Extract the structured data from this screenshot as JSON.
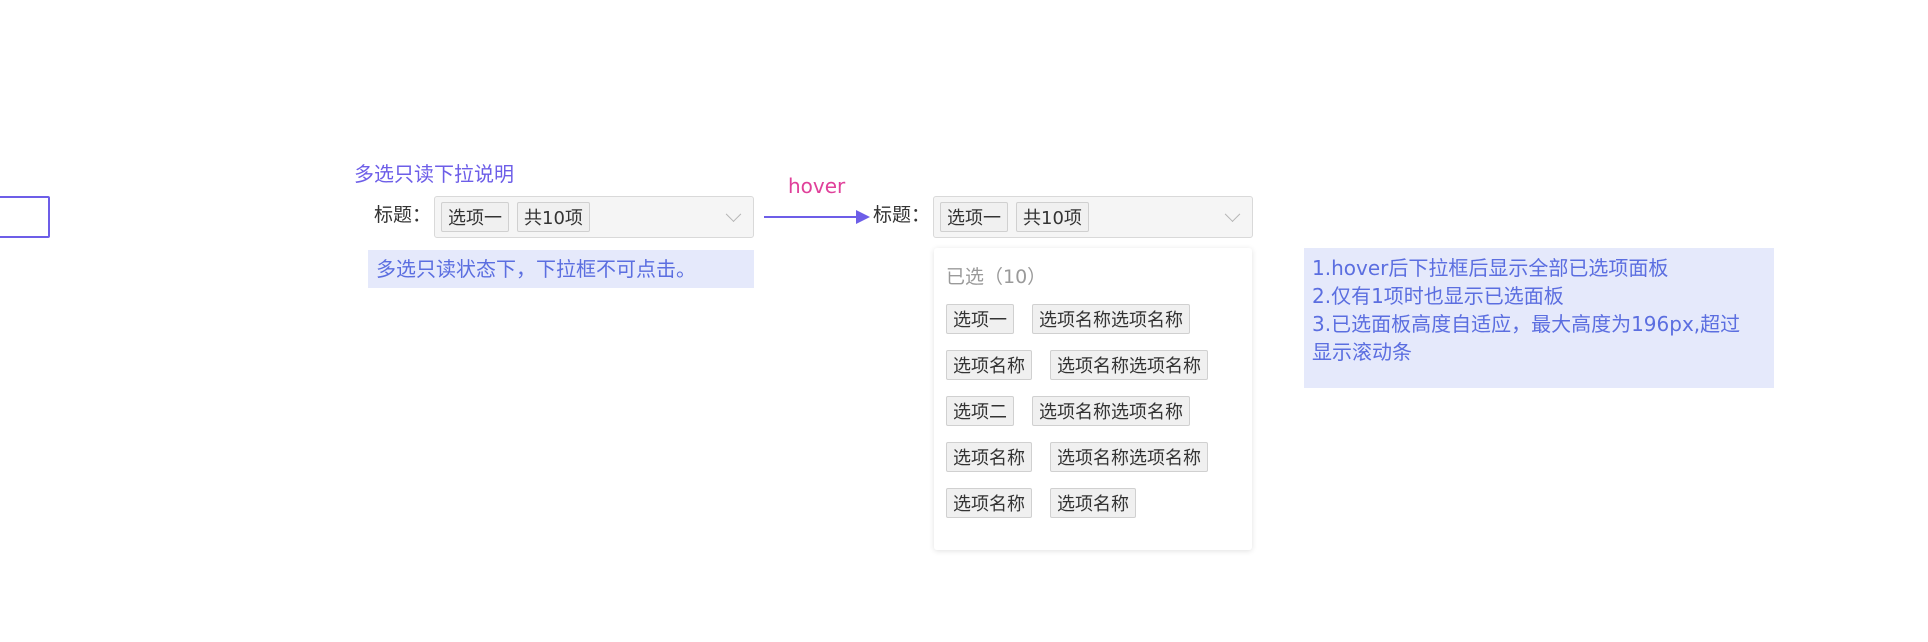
{
  "left_section": {
    "title": "多选只读下拉说明",
    "field_label": "标题：",
    "select_tags": [
      "选项一",
      "共10项"
    ],
    "note": "多选只读状态下，下拉框不可点击。"
  },
  "transition": {
    "label": "hover"
  },
  "right_section": {
    "field_label": "标题：",
    "select_tags": [
      "选项一",
      "共10项"
    ],
    "panel": {
      "title": "已选（10）",
      "rows": [
        [
          "选项一",
          "选项名称选项名称"
        ],
        [
          "选项名称",
          "选项名称选项名称"
        ],
        [
          "选项二",
          "选项名称选项名称"
        ],
        [
          "选项名称",
          "选项名称选项名称"
        ],
        [
          "选项名称",
          "选项名称"
        ]
      ]
    }
  },
  "notes": {
    "lines": [
      "1.hover后下拉框后显示全部已选项面板",
      "2.仅有1项时也显示已选面板",
      "3.已选面板高度自适应，最大高度为196px,超过",
      "显示滚动条"
    ]
  },
  "colors": {
    "accent": "#6d5ee8",
    "hover_label": "#e0409a",
    "note_bg": "#e5e9fb",
    "note_text": "#5b6ee0"
  }
}
